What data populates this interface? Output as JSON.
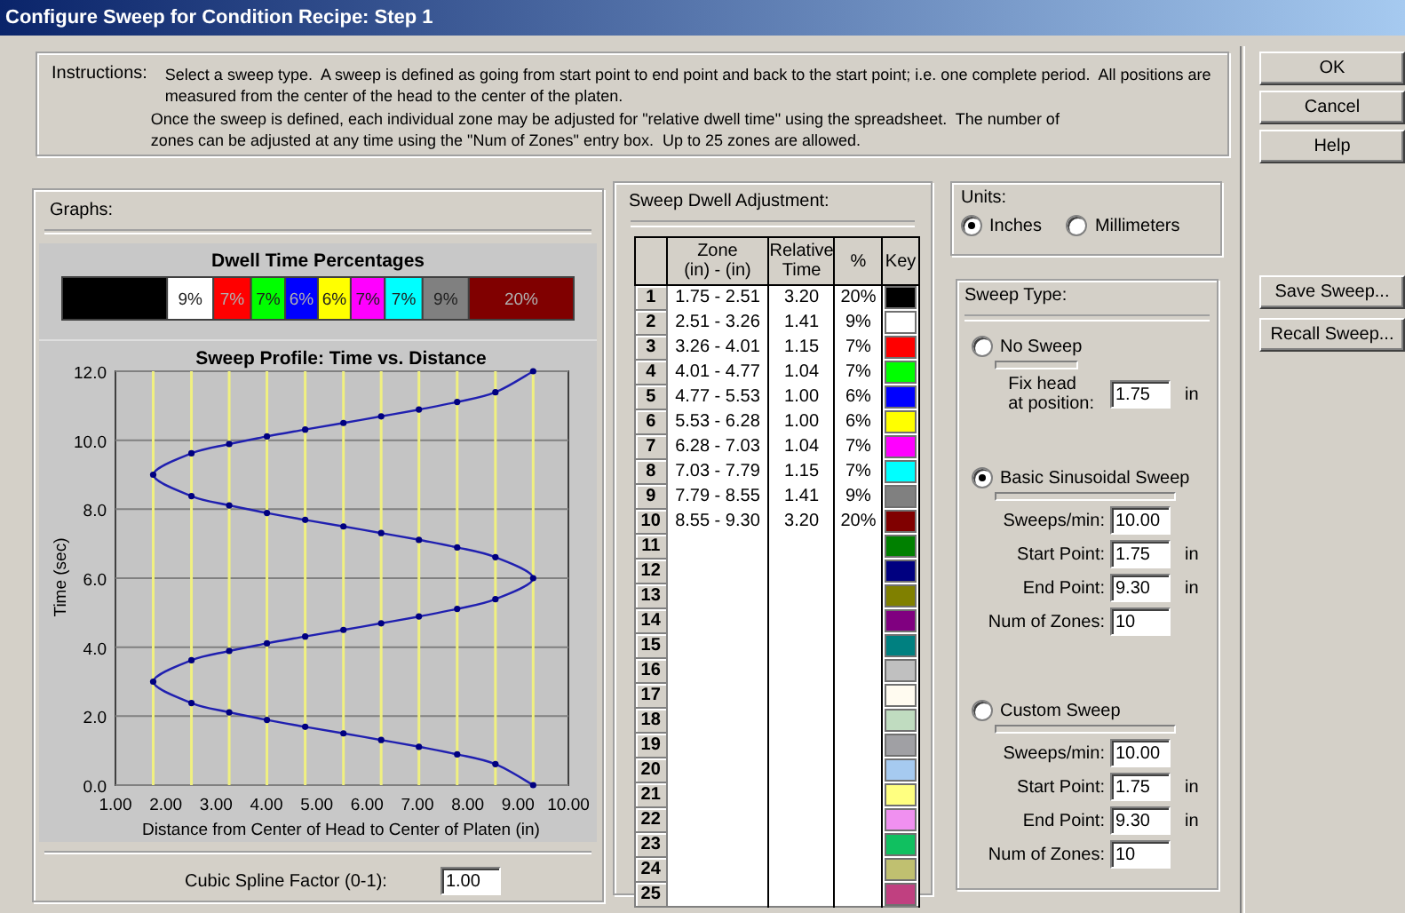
{
  "window": {
    "title": "Configure Sweep for Condition Recipe: Step 1"
  },
  "instructions": {
    "label": "Instructions:",
    "paragraphs": [
      "Select a sweep type.  A sweep is defined as going from start point to end point and back to the start point; i.e. one complete period.  All positions are measured from the center of the head to the center of the platen.",
      "Once the sweep is defined, each individual zone may be adjusted for \"relative dwell time\" using the spreadsheet.  The number of zones can be adjusted at any time using the \"Num of Zones\" entry box.  Up to 25 zones are allowed."
    ]
  },
  "graphs": {
    "label": "Graphs:",
    "dwell_bar": {
      "title": "Dwell Time Percentages",
      "segments": [
        {
          "color": "#000000"
        },
        {
          "label": "9%",
          "color": "#ffffff"
        },
        {
          "label": "7%",
          "color": "#ff0000"
        },
        {
          "label": "7%",
          "color": "#00ff00"
        },
        {
          "label": "6%",
          "color": "#0000ff"
        },
        {
          "label": "6%",
          "color": "#ffff00"
        },
        {
          "label": "7%",
          "color": "#ff00ff"
        },
        {
          "label": "7%",
          "color": "#00ffff"
        },
        {
          "label": "9%",
          "color": "#808080"
        },
        {
          "label": "20%",
          "color": "#800000"
        }
      ]
    },
    "profile_chart": {
      "chart_data": {
        "type": "line",
        "title": "Sweep Profile: Time vs. Distance",
        "xlabel": "Distance from Center of Head to Center of Platen (in)",
        "ylabel": "Time (sec)",
        "xlim": [
          1,
          10
        ],
        "ylim": [
          0,
          12
        ],
        "grid": true,
        "xticks": [
          {
            "value": 1,
            "label": "1.00"
          },
          {
            "value": 2,
            "label": "2.00"
          },
          {
            "value": 3,
            "label": "3.00"
          },
          {
            "value": 4,
            "label": "4.00"
          },
          {
            "value": 5,
            "label": "5.00"
          },
          {
            "value": 6,
            "label": "6.00"
          },
          {
            "value": 7,
            "label": "7.00"
          },
          {
            "value": 8,
            "label": "8.00"
          },
          {
            "value": 9,
            "label": "9.00"
          },
          {
            "value": 10,
            "label": "10.00"
          }
        ],
        "yticks": [
          {
            "value": 0,
            "label": "0.0"
          },
          {
            "value": 2,
            "label": "2.0"
          },
          {
            "value": 4,
            "label": "4.0"
          },
          {
            "value": 6,
            "label": "6.0"
          },
          {
            "value": 8,
            "label": "8.0"
          },
          {
            "value": 10,
            "label": "10.0"
          },
          {
            "value": 12,
            "label": "12.0"
          }
        ],
        "x": [
          9.3,
          8.55,
          7.79,
          7.03,
          6.28,
          5.53,
          4.77,
          4.01,
          3.26,
          2.51,
          1.75,
          2.51,
          3.26,
          4.01,
          4.77,
          5.53,
          6.28,
          7.03,
          7.79,
          8.55,
          9.3,
          8.55,
          7.79,
          7.03,
          6.28,
          5.53,
          4.77,
          4.01,
          3.26,
          2.51,
          1.75,
          2.51,
          3.26,
          4.01,
          4.77,
          5.53,
          6.28,
          7.03,
          7.79,
          8.55,
          9.3
        ],
        "series": [
          {
            "color": "#2020b0",
            "marker": "circle",
            "values": [
              0,
              0.61,
              0.89,
              1.11,
              1.31,
              1.5,
              1.69,
              1.89,
              2.11,
              2.38,
              3.0,
              3.62,
              3.89,
              4.11,
              4.31,
              4.5,
              4.69,
              4.89,
              5.11,
              5.39,
              6.0,
              6.61,
              6.89,
              7.11,
              7.31,
              7.5,
              7.69,
              7.89,
              8.11,
              8.38,
              9.0,
              9.62,
              9.89,
              10.11,
              10.31,
              10.5,
              10.69,
              10.89,
              11.11,
              11.39,
              12.0
            ]
          }
        ]
      }
    },
    "spline": {
      "label": "Cubic Spline Factor (0-1):",
      "value": "1.00"
    }
  },
  "dwell": {
    "label": "Sweep Dwell Adjustment:",
    "columns": [
      "Zone\n(in) - (in)",
      "Relative\nTime",
      "%",
      "Key"
    ],
    "rows": [
      {
        "number": "1",
        "zone": "1.75 - 2.51",
        "relative_time": "3.20",
        "percent": "20%",
        "color": "#000000"
      },
      {
        "number": "2",
        "zone": "2.51 - 3.26",
        "relative_time": "1.41",
        "percent": "9%",
        "color": "#ffffff"
      },
      {
        "number": "3",
        "zone": "3.26 - 4.01",
        "relative_time": "1.15",
        "percent": "7%",
        "color": "#ff0000"
      },
      {
        "number": "4",
        "zone": "4.01 - 4.77",
        "relative_time": "1.04",
        "percent": "7%",
        "color": "#00ff00"
      },
      {
        "number": "5",
        "zone": "4.77 - 5.53",
        "relative_time": "1.00",
        "percent": "6%",
        "color": "#0000ff"
      },
      {
        "number": "6",
        "zone": "5.53 - 6.28",
        "relative_time": "1.00",
        "percent": "6%",
        "color": "#ffff00"
      },
      {
        "number": "7",
        "zone": "6.28 - 7.03",
        "relative_time": "1.04",
        "percent": "7%",
        "color": "#ff00ff"
      },
      {
        "number": "8",
        "zone": "7.03 - 7.79",
        "relative_time": "1.15",
        "percent": "7%",
        "color": "#00ffff"
      },
      {
        "number": "9",
        "zone": "7.79 - 8.55",
        "relative_time": "1.41",
        "percent": "9%",
        "color": "#808080"
      },
      {
        "number": "10",
        "zone": "8.55 - 9.30",
        "relative_time": "3.20",
        "percent": "20%",
        "color": "#800000"
      },
      {
        "number": "11",
        "color": "#008000"
      },
      {
        "number": "12",
        "color": "#000080"
      },
      {
        "number": "13",
        "color": "#808000"
      },
      {
        "number": "14",
        "color": "#800080"
      },
      {
        "number": "15",
        "color": "#008080"
      },
      {
        "number": "16",
        "color": "#c0c0c0"
      },
      {
        "number": "17",
        "color": "#fffbf0"
      },
      {
        "number": "18",
        "color": "#c0dcc0"
      },
      {
        "number": "19",
        "color": "#a0a0a4"
      },
      {
        "number": "20",
        "color": "#a6caf0"
      },
      {
        "number": "21",
        "color": "#ffff80"
      },
      {
        "number": "22",
        "color": "#f090f0"
      },
      {
        "number": "23",
        "color": "#10c060"
      },
      {
        "number": "24",
        "color": "#c0c070"
      },
      {
        "number": "25",
        "color": "#c04080"
      }
    ]
  },
  "units": {
    "label": "Units:",
    "options": [
      {
        "label": "Inches",
        "selected": true
      },
      {
        "label": "Millimeters",
        "selected": false
      }
    ]
  },
  "sweep_type": {
    "label": "Sweep Type:",
    "options": [
      {
        "label": "No Sweep",
        "selected": false,
        "fields": [
          {
            "label": "Fix head\nat position:",
            "value": "1.75",
            "unit": "in"
          }
        ]
      },
      {
        "label": "Basic Sinusoidal Sweep",
        "selected": true,
        "fields": [
          {
            "label": "Sweeps/min:",
            "value": "10.00"
          },
          {
            "label": "Start Point:",
            "value": "1.75",
            "unit": "in"
          },
          {
            "label": "End Point:",
            "value": "9.30",
            "unit": "in"
          },
          {
            "label": "Num of Zones:",
            "value": "10"
          }
        ]
      },
      {
        "label": "Custom Sweep",
        "selected": false,
        "fields": [
          {
            "label": "Sweeps/min:",
            "value": "10.00"
          },
          {
            "label": "Start Point:",
            "value": "1.75",
            "unit": "in"
          },
          {
            "label": "End Point:",
            "value": "9.30",
            "unit": "in"
          },
          {
            "label": "Num of Zones:",
            "value": "10"
          }
        ]
      }
    ]
  },
  "buttons": [
    "OK",
    "Cancel",
    "Help"
  ],
  "sweep_buttons": [
    "Save Sweep...",
    "Recall Sweep..."
  ]
}
